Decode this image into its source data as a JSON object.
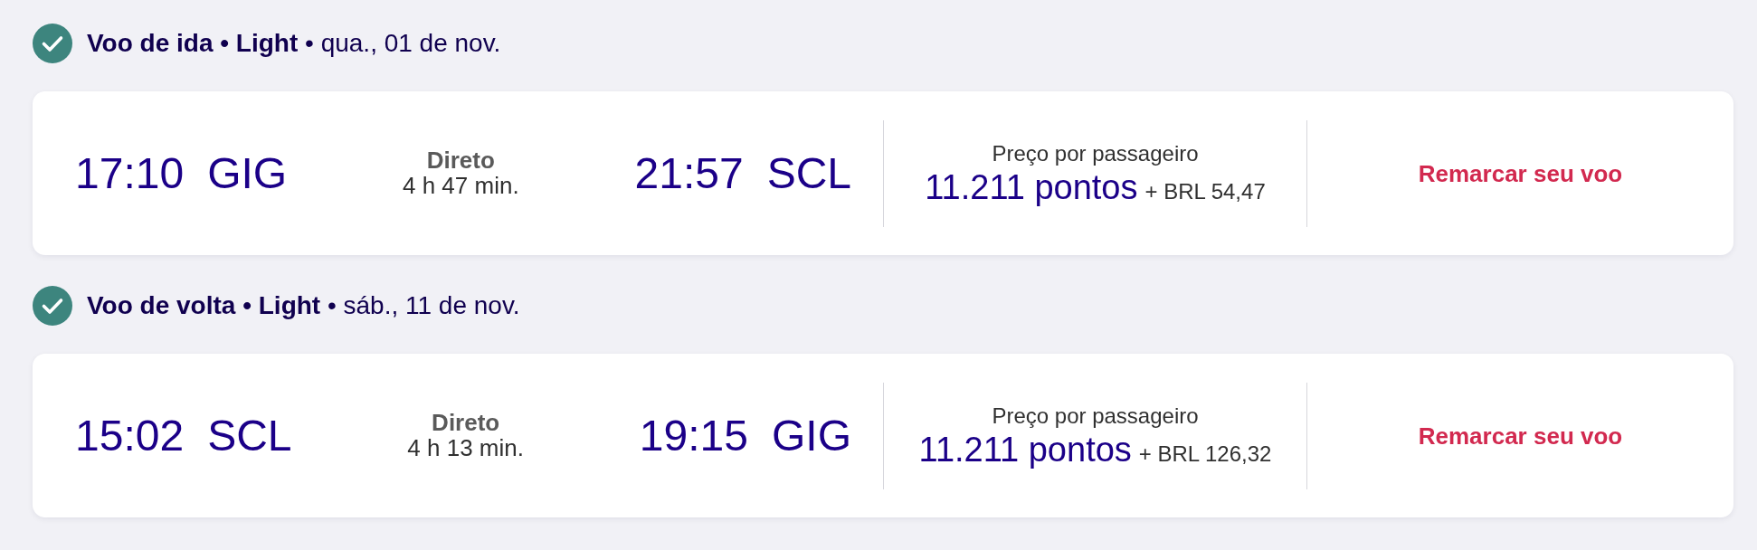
{
  "flights": [
    {
      "checked": true,
      "heading": "**Voo de ida • Light** • qua., 01 de nov.",
      "departure": {
        "time": "17:10",
        "airport": "GIG"
      },
      "stops": "Direto",
      "duration": "4 h 47 min.",
      "arrival": {
        "time": "21:57",
        "airport": "SCL"
      },
      "price": {
        "label": "Preço por passageiro",
        "points": "11.211 pontos",
        "extra": "+ BRL 54,47"
      },
      "action": "Remarcar seu voo"
    },
    {
      "checked": true,
      "heading": "**Voo de volta • Light** • sáb., 11 de nov.",
      "departure": {
        "time": "15:02",
        "airport": "SCL"
      },
      "stops": "Direto",
      "duration": "4 h 13 min.",
      "arrival": {
        "time": "19:15",
        "airport": "GIG"
      },
      "price": {
        "label": "Preço por passageiro",
        "points": "11.211 pontos",
        "extra": "+ BRL 126,32"
      },
      "action": "Remarcar seu voo"
    }
  ]
}
